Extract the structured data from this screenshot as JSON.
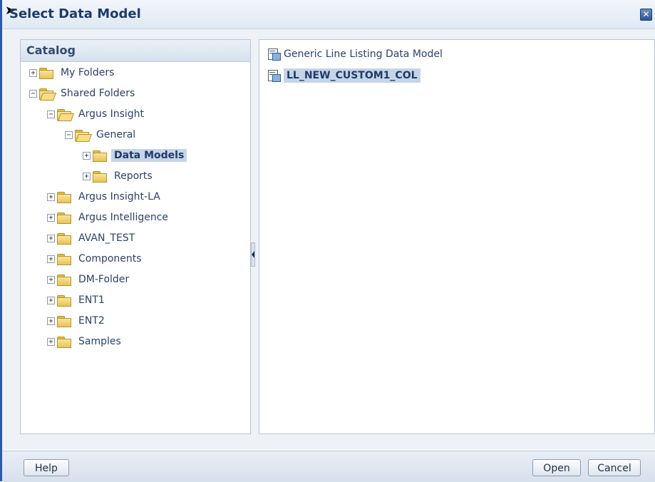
{
  "window": {
    "title": "Select Data Model",
    "close_glyph": "✕"
  },
  "catalog": {
    "header": "Catalog",
    "tree": [
      {
        "label": "My Folders",
        "expander": "+",
        "open": false,
        "level": 0
      },
      {
        "label": "Shared Folders",
        "expander": "−",
        "open": true,
        "level": 0
      },
      {
        "label": "Argus Insight",
        "expander": "−",
        "open": true,
        "level": 1
      },
      {
        "label": "General",
        "expander": "−",
        "open": true,
        "level": 2
      },
      {
        "label": "Data Models",
        "expander": "+",
        "open": false,
        "level": 3,
        "selected": true
      },
      {
        "label": "Reports",
        "expander": "+",
        "open": false,
        "level": 3
      },
      {
        "label": "Argus Insight-LA",
        "expander": "+",
        "open": false,
        "level": 1
      },
      {
        "label": "Argus Intelligence",
        "expander": "+",
        "open": false,
        "level": 1
      },
      {
        "label": "AVAN_TEST",
        "expander": "+",
        "open": false,
        "level": 1
      },
      {
        "label": "Components",
        "expander": "+",
        "open": false,
        "level": 1
      },
      {
        "label": "DM-Folder",
        "expander": "+",
        "open": false,
        "level": 1
      },
      {
        "label": "ENT1",
        "expander": "+",
        "open": false,
        "level": 1
      },
      {
        "label": "ENT2",
        "expander": "+",
        "open": false,
        "level": 1
      },
      {
        "label": "Samples",
        "expander": "+",
        "open": false,
        "level": 1
      }
    ]
  },
  "contents": {
    "items": [
      {
        "label": "Generic Line Listing Data Model",
        "selected": false
      },
      {
        "label": "LL_NEW_CUSTOM1_COL",
        "selected": true
      }
    ]
  },
  "buttons": {
    "help": "Help",
    "open": "Open",
    "cancel": "Cancel"
  },
  "colors": {
    "title": "#1d3b6a",
    "selection": "#c6d4e7",
    "folder": "#e9c35a"
  }
}
